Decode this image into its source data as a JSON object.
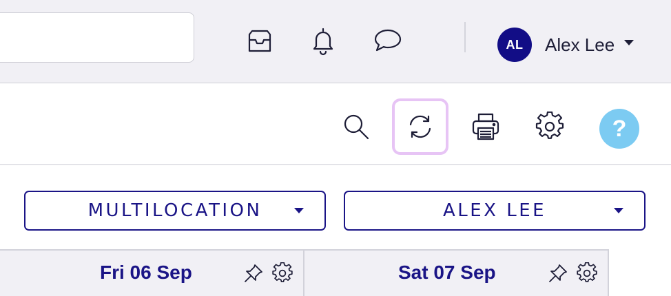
{
  "header": {
    "search": {
      "value": "",
      "placeholder": ""
    },
    "icons": [
      "inbox-icon",
      "bell-icon",
      "chat-icon"
    ],
    "user": {
      "initials": "AL",
      "name": "Alex Lee",
      "avatar_color": "#120d86"
    }
  },
  "toolbar": {
    "icons": [
      "search-icon",
      "refresh-icon",
      "printer-icon",
      "gear-icon",
      "help-icon"
    ],
    "active": "refresh-icon",
    "help_label": "?",
    "help_color": "#7ccbf2",
    "active_outline_color": "#e7c4f5"
  },
  "filters": {
    "location": "MULTILOCATION",
    "person": "ALEX LEE"
  },
  "days": [
    {
      "label": "Fri 06 Sep"
    },
    {
      "label": "Sat 07 Sep"
    }
  ],
  "colors": {
    "accent": "#1a1486",
    "header_bg": "#f1f0f5"
  }
}
